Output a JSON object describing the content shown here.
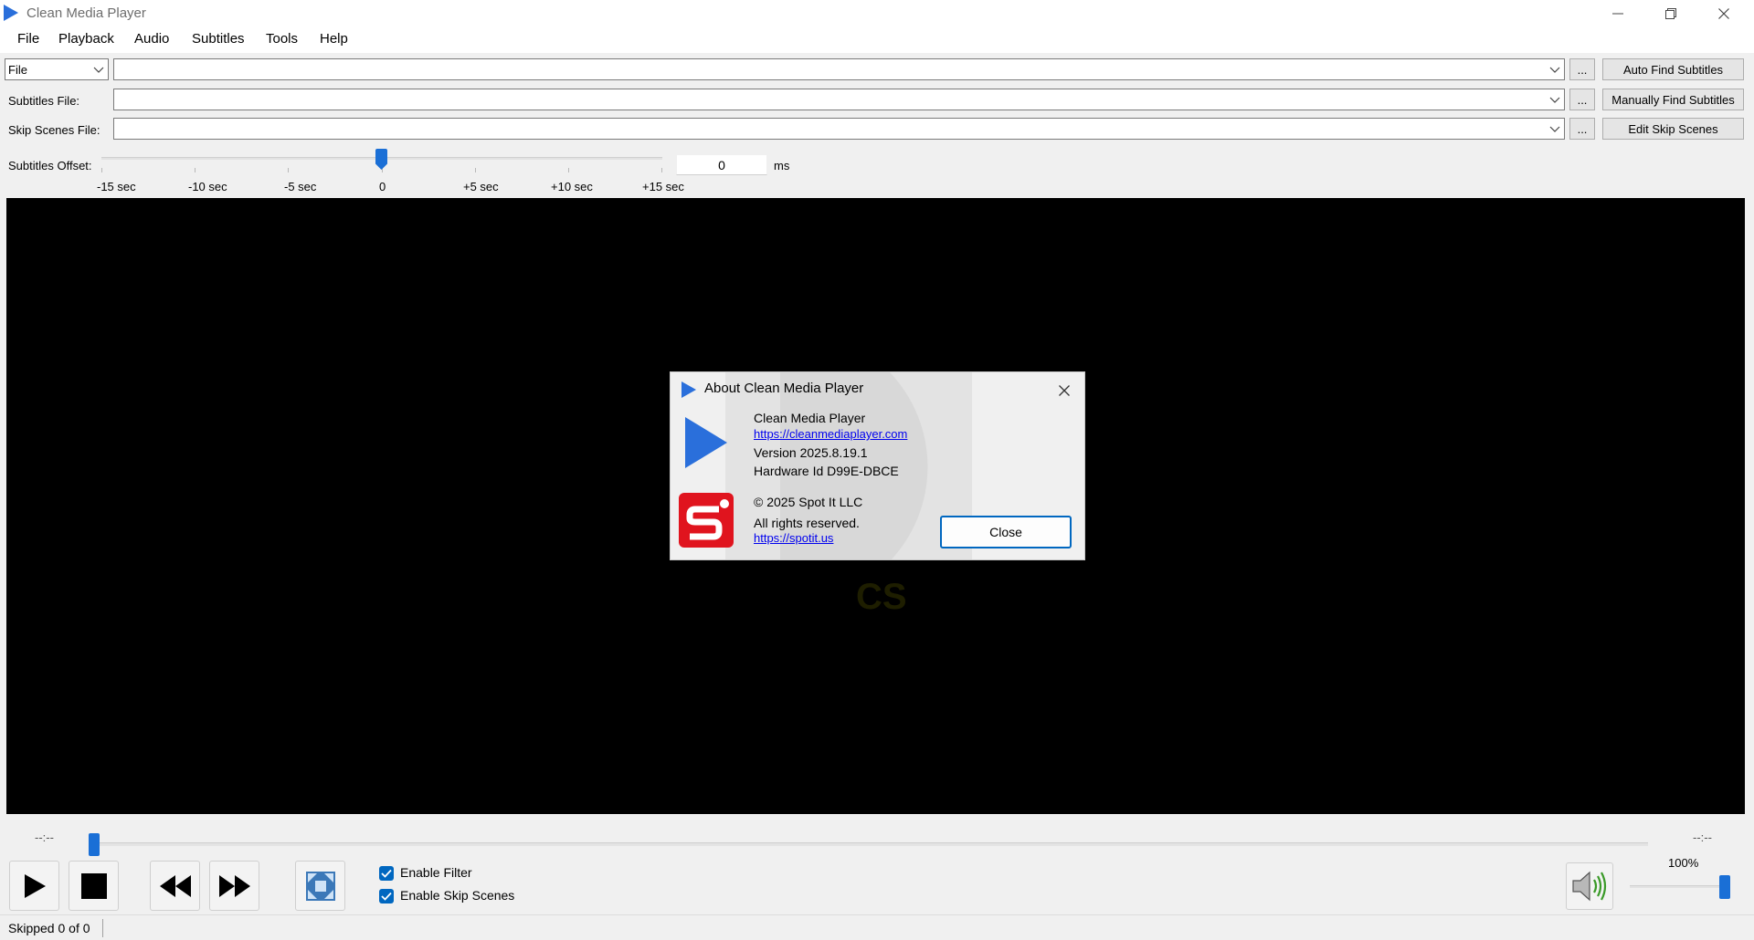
{
  "window": {
    "title": "Clean Media Player"
  },
  "menu": [
    "File",
    "Playback",
    "Audio",
    "Subtitles",
    "Tools",
    "Help"
  ],
  "source": {
    "type_selected": "File",
    "path_value": "",
    "browse_label": "...",
    "auto_find_label": "Auto Find Subtitles"
  },
  "subtitles_file": {
    "label": "Subtitles File:",
    "value": "",
    "browse_label": "...",
    "manual_find_label": "Manually Find Subtitles"
  },
  "skip_scenes_file": {
    "label": "Skip Scenes File:",
    "value": "",
    "browse_label": "...",
    "edit_label": "Edit Skip Scenes"
  },
  "subtitles_offset": {
    "label": "Subtitles Offset:",
    "value": "0",
    "unit": "ms",
    "ticks": [
      "-15 sec",
      "-10 sec",
      "-5 sec",
      "0",
      "+5 sec",
      "+10 sec",
      "+15 sec"
    ]
  },
  "playback": {
    "time_left": "--:--",
    "time_right": "--:--",
    "enable_filter_label": "Enable Filter",
    "enable_filter_checked": true,
    "enable_skip_label": "Enable Skip Scenes",
    "enable_skip_checked": true,
    "volume_label": "100%",
    "volume_level": 1.0
  },
  "status": {
    "text": "Skipped 0 of 0"
  },
  "about_dialog": {
    "title": "About Clean Media Player",
    "app_name": "Clean Media Player",
    "app_url": "https://cleanmediaplayer.com",
    "version": "Version 2025.8.19.1",
    "hardware_id": "Hardware Id D99E-DBCE",
    "copyright": "© 2025 Spot It LLC",
    "rights": "All rights reserved.",
    "company_url": "https://spotit.us",
    "close_label": "Close"
  },
  "colors": {
    "accent": "#0067c0",
    "logo_blue": "#2a6fdb",
    "logo_red": "#e0141e",
    "video_bg": "#000000"
  },
  "icons": [
    "play-icon",
    "stop-icon",
    "rewind-icon",
    "fast-forward-icon",
    "fullscreen-icon",
    "speaker-icon",
    "chevron-down-icon",
    "close-icon"
  ]
}
